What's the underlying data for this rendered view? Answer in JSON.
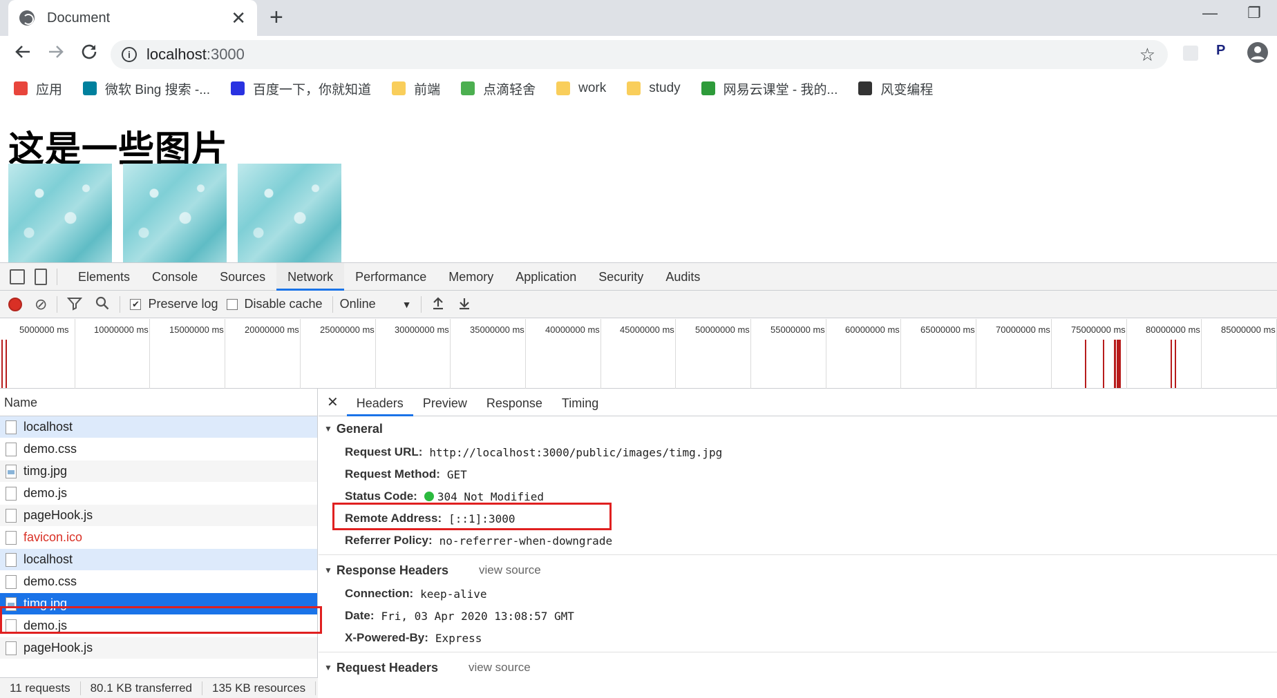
{
  "browser": {
    "tab_title": "Document",
    "close_glyph": "✕",
    "new_tab_glyph": "+",
    "minimize_glyph": "—",
    "restore_glyph": "❐",
    "url_host": "localhost",
    "url_port": ":3000"
  },
  "bookmarks": [
    {
      "label": "应用",
      "color": "#e8453c"
    },
    {
      "label": "微软 Bing 搜索 -...",
      "color": "#00809d"
    },
    {
      "label": "百度一下，你就知道",
      "color": "#2932e1"
    },
    {
      "label": "前端",
      "color": "#f9ce5b"
    },
    {
      "label": "点滴轻舍",
      "color": "#4caf50"
    },
    {
      "label": "work",
      "color": "#f9ce5b"
    },
    {
      "label": "study",
      "color": "#f9ce5b"
    },
    {
      "label": "网易云课堂 - 我的...",
      "color": "#2e9b3a"
    },
    {
      "label": "风变编程",
      "color": "#333333"
    }
  ],
  "page": {
    "heading": "这是一些图片"
  },
  "devtools": {
    "tabs": [
      "Elements",
      "Console",
      "Sources",
      "Network",
      "Performance",
      "Memory",
      "Application",
      "Security",
      "Audits"
    ],
    "active_tab": "Network",
    "preserve_log": "Preserve log",
    "disable_cache": "Disable cache",
    "throttle": "Online",
    "timeline_ticks": [
      "5000000 ms",
      "10000000 ms",
      "15000000 ms",
      "20000000 ms",
      "25000000 ms",
      "30000000 ms",
      "35000000 ms",
      "40000000 ms",
      "45000000 ms",
      "50000000 ms",
      "55000000 ms",
      "60000000 ms",
      "65000000 ms",
      "70000000 ms",
      "75000000 ms",
      "80000000 ms",
      "85000000 ms"
    ],
    "name_header": "Name",
    "requests": [
      {
        "name": "localhost",
        "type": "doc",
        "state": "hl"
      },
      {
        "name": "demo.css",
        "type": "doc",
        "state": ""
      },
      {
        "name": "timg.jpg",
        "type": "img",
        "state": "alt"
      },
      {
        "name": "demo.js",
        "type": "doc",
        "state": ""
      },
      {
        "name": "pageHook.js",
        "type": "doc",
        "state": "alt"
      },
      {
        "name": "favicon.ico",
        "type": "doc",
        "state": "err"
      },
      {
        "name": "localhost",
        "type": "doc",
        "state": "hl"
      },
      {
        "name": "demo.css",
        "type": "doc",
        "state": ""
      },
      {
        "name": "timg.jpg",
        "type": "img",
        "state": "sel"
      },
      {
        "name": "demo.js",
        "type": "doc",
        "state": ""
      },
      {
        "name": "pageHook.js",
        "type": "doc",
        "state": "alt"
      }
    ],
    "summary": {
      "requests": "11 requests",
      "transferred": "80.1 KB transferred",
      "resources": "135 KB resources"
    },
    "detail_tabs": [
      "Headers",
      "Preview",
      "Response",
      "Timing"
    ],
    "general": {
      "title": "General",
      "request_url_k": "Request URL:",
      "request_url_v": "http://localhost:3000/public/images/timg.jpg",
      "method_k": "Request Method:",
      "method_v": "GET",
      "status_k": "Status Code:",
      "status_v": "304 Not Modified",
      "remote_k": "Remote Address:",
      "remote_v": "[::1]:3000",
      "referrer_k": "Referrer Policy:",
      "referrer_v": "no-referrer-when-downgrade"
    },
    "response_headers": {
      "title": "Response Headers",
      "view_source": "view source",
      "connection_k": "Connection:",
      "connection_v": "keep-alive",
      "date_k": "Date:",
      "date_v": "Fri, 03 Apr 2020 13:08:57 GMT",
      "powered_k": "X-Powered-By:",
      "powered_v": "Express"
    },
    "request_headers": {
      "title": "Request Headers",
      "view_source": "view source"
    }
  }
}
